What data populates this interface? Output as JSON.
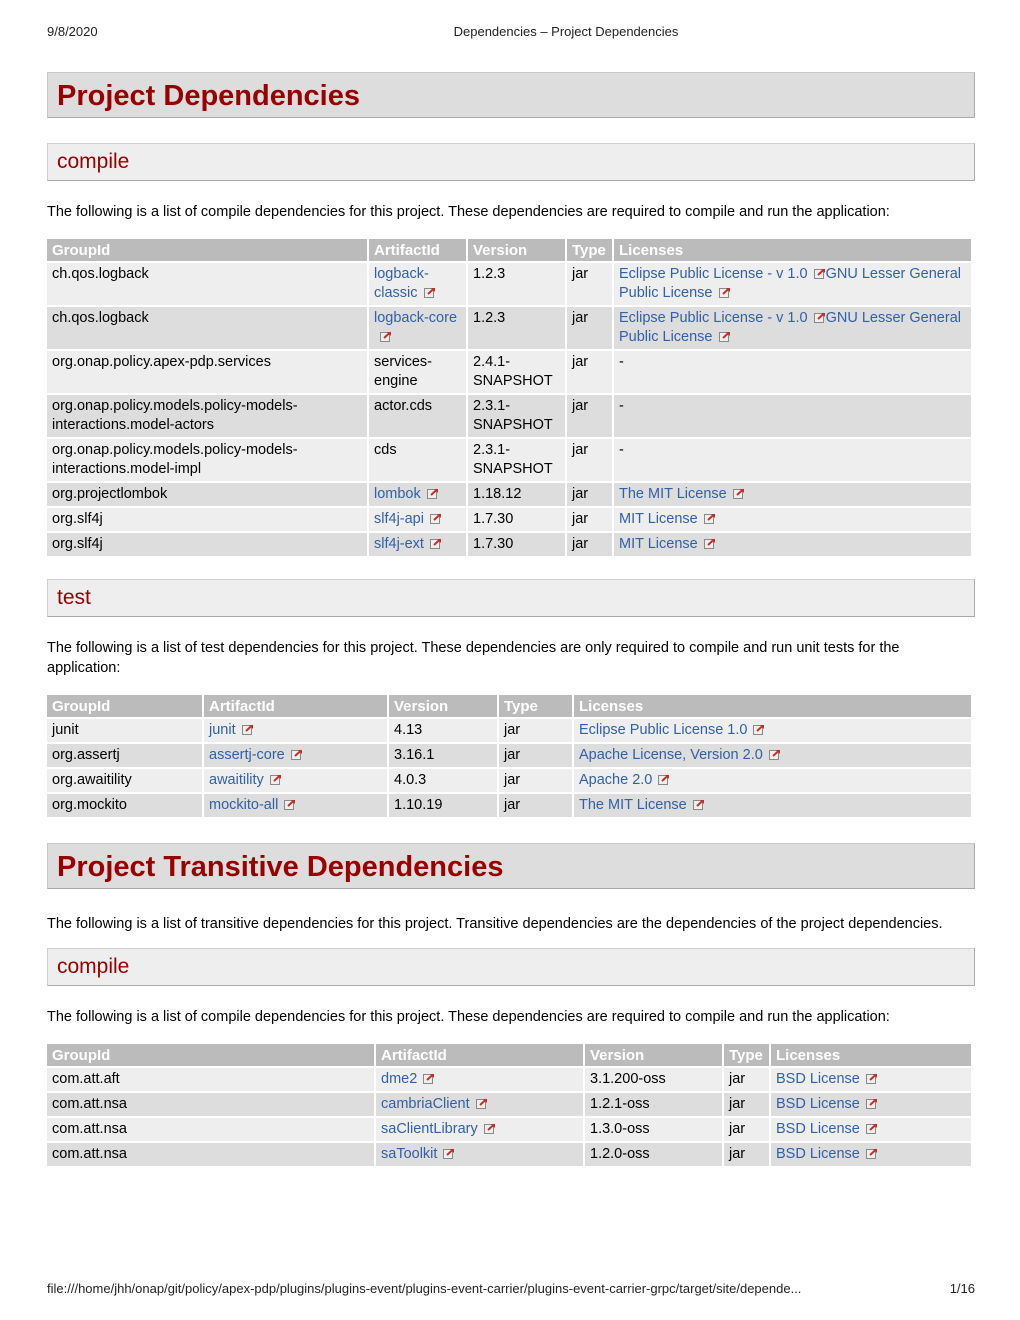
{
  "print_header": {
    "date": "9/8/2020",
    "title": "Dependencies – Project Dependencies"
  },
  "project_dependencies": {
    "heading": "Project Dependencies",
    "compile": {
      "heading": "compile",
      "description": "The following is a list of compile dependencies for this project. These dependencies are required to compile and run the application:",
      "columns": [
        "GroupId",
        "ArtifactId",
        "Version",
        "Type",
        "Licenses"
      ],
      "rows": [
        {
          "group": "ch.qos.logback",
          "artifact": "logback-classic",
          "artifact_link": true,
          "version": "1.2.3",
          "type": "jar",
          "licenses": [
            {
              "name": "Eclipse Public License - v 1.0",
              "link": true
            },
            {
              "name": "GNU Lesser General Public License",
              "link": true
            }
          ]
        },
        {
          "group": "ch.qos.logback",
          "artifact": "logback-core",
          "artifact_link": true,
          "version": "1.2.3",
          "type": "jar",
          "licenses": [
            {
              "name": "Eclipse Public License - v 1.0",
              "link": true
            },
            {
              "name": "GNU Lesser General Public License",
              "link": true
            }
          ]
        },
        {
          "group": "org.onap.policy.apex-pdp.services",
          "artifact": "services-engine",
          "artifact_link": false,
          "version": "2.4.1-SNAPSHOT",
          "type": "jar",
          "licenses_text": "-"
        },
        {
          "group": "org.onap.policy.models.policy-models-interactions.model-actors",
          "artifact": "actor.cds",
          "artifact_link": false,
          "version": "2.3.1-SNAPSHOT",
          "type": "jar",
          "licenses_text": "-"
        },
        {
          "group": "org.onap.policy.models.policy-models-interactions.model-impl",
          "artifact": "cds",
          "artifact_link": false,
          "version": "2.3.1-SNAPSHOT",
          "type": "jar",
          "licenses_text": "-"
        },
        {
          "group": "org.projectlombok",
          "artifact": "lombok",
          "artifact_link": true,
          "version": "1.18.12",
          "type": "jar",
          "licenses": [
            {
              "name": "The MIT License",
              "link": true
            }
          ]
        },
        {
          "group": "org.slf4j",
          "artifact": "slf4j-api",
          "artifact_link": true,
          "version": "1.7.30",
          "type": "jar",
          "licenses": [
            {
              "name": "MIT License",
              "link": true
            }
          ]
        },
        {
          "group": "org.slf4j",
          "artifact": "slf4j-ext",
          "artifact_link": true,
          "version": "1.7.30",
          "type": "jar",
          "licenses": [
            {
              "name": "MIT License",
              "link": true
            }
          ]
        }
      ]
    },
    "test": {
      "heading": "test",
      "description": "The following is a list of test dependencies for this project. These dependencies are only required to compile and run unit tests for the application:",
      "columns": [
        "GroupId",
        "ArtifactId",
        "Version",
        "Type",
        "Licenses"
      ],
      "rows": [
        {
          "group": "junit",
          "artifact": "junit",
          "artifact_link": true,
          "version": "4.13",
          "type": "jar",
          "licenses": [
            {
              "name": "Eclipse Public License 1.0",
              "link": true
            }
          ]
        },
        {
          "group": "org.assertj",
          "artifact": "assertj-core",
          "artifact_link": true,
          "version": "3.16.1",
          "type": "jar",
          "licenses": [
            {
              "name": "Apache License, Version 2.0",
              "link": true
            }
          ]
        },
        {
          "group": "org.awaitility",
          "artifact": "awaitility",
          "artifact_link": true,
          "version": "4.0.3",
          "type": "jar",
          "licenses": [
            {
              "name": "Apache 2.0",
              "link": true
            }
          ]
        },
        {
          "group": "org.mockito",
          "artifact": "mockito-all",
          "artifact_link": true,
          "version": "1.10.19",
          "type": "jar",
          "licenses": [
            {
              "name": "The MIT License",
              "link": true
            }
          ]
        }
      ]
    }
  },
  "transitive_dependencies": {
    "heading": "Project Transitive Dependencies",
    "description": "The following is a list of transitive dependencies for this project. Transitive dependencies are the dependencies of the project dependencies.",
    "compile": {
      "heading": "compile",
      "description": "The following is a list of compile dependencies for this project. These dependencies are required to compile and run the application:",
      "columns": [
        "GroupId",
        "ArtifactId",
        "Version",
        "Type",
        "Licenses"
      ],
      "rows": [
        {
          "group": "com.att.aft",
          "artifact": "dme2",
          "artifact_link": true,
          "version": "3.1.200-oss",
          "type": "jar",
          "licenses": [
            {
              "name": "BSD License",
              "link": true
            }
          ]
        },
        {
          "group": "com.att.nsa",
          "artifact": "cambriaClient",
          "artifact_link": true,
          "version": "1.2.1-oss",
          "type": "jar",
          "licenses": [
            {
              "name": "BSD License",
              "link": true
            }
          ]
        },
        {
          "group": "com.att.nsa",
          "artifact": "saClientLibrary",
          "artifact_link": true,
          "version": "1.3.0-oss",
          "type": "jar",
          "licenses": [
            {
              "name": "BSD License",
              "link": true
            }
          ]
        },
        {
          "group": "com.att.nsa",
          "artifact": "saToolkit",
          "artifact_link": true,
          "version": "1.2.0-oss",
          "type": "jar",
          "licenses": [
            {
              "name": "BSD License",
              "link": true
            }
          ]
        }
      ]
    }
  },
  "print_footer": {
    "url": "file:///home/jhh/onap/git/policy/apex-pdp/plugins/plugins-event/plugins-event-carrier/plugins-event-carrier-grpc/target/site/depende...",
    "page": "1/16"
  },
  "colors": {
    "heading": "#990000",
    "link": "#3060a8",
    "table_header_bg": "#bbbbbb",
    "row_a": "#eeeeee",
    "row_b": "#dddddd"
  }
}
